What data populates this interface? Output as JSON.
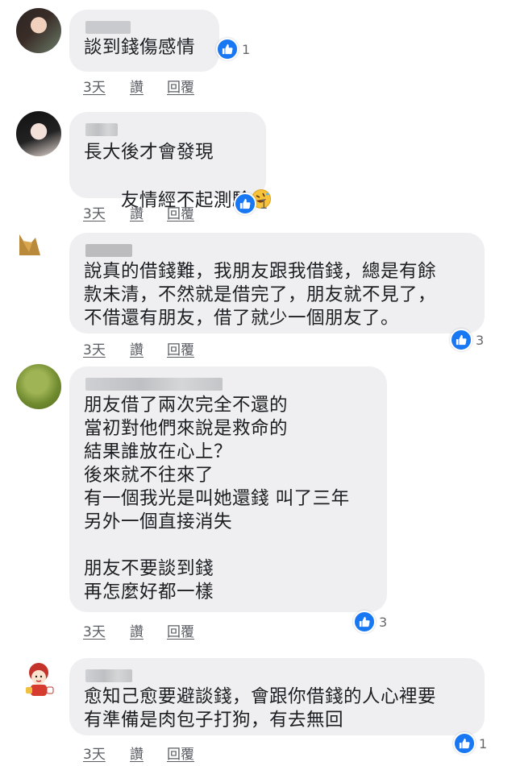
{
  "comments": [
    {
      "lines": [
        "談到錢傷感情"
      ],
      "reactions": "1",
      "actions": {
        "time": "3天",
        "like": "讚",
        "reply": "回覆"
      }
    },
    {
      "lines": [
        "長大後才會發現",
        "友情經不起測驗"
      ],
      "emoji": "rolling-on-floor-laughing-emoji",
      "reactions": "1",
      "actions": {
        "time": "3天",
        "like": "讚",
        "reply": "回覆"
      }
    },
    {
      "lines": [
        "說真的借錢難，我朋友跟我借錢，總是有餘",
        "款未清，不然就是借完了，朋友就不見了，",
        "不借還有朋友，借了就少一個朋友了。"
      ],
      "reactions": "3",
      "actions": {
        "time": "3天",
        "like": "讚",
        "reply": "回覆"
      }
    },
    {
      "lines": [
        "朋友借了兩次完全不還的",
        "當初對他們來說是救命的",
        "結果誰放在心上？",
        "後來就不往來了",
        "有一個我光是叫她還錢 叫了三年",
        "另外一個直接消失",
        "",
        "朋友不要談到錢",
        "再怎麼好都一樣"
      ],
      "reactions": "3",
      "actions": {
        "time": "3天",
        "like": "讚",
        "reply": "回覆"
      }
    },
    {
      "lines": [
        "愈知己愈要避談錢，會跟你借錢的人心裡要",
        "有準備是肉包子打狗，有去無回"
      ],
      "reactions": "1",
      "actions": {
        "time": "3天",
        "like": "讚",
        "reply": "回覆"
      }
    }
  ],
  "icons": {
    "reaction": "like-thumbs-up-icon"
  },
  "colors": {
    "bubble": "#efeff2",
    "like_badge": "#1877f2",
    "action_text": "#5a5d63"
  }
}
